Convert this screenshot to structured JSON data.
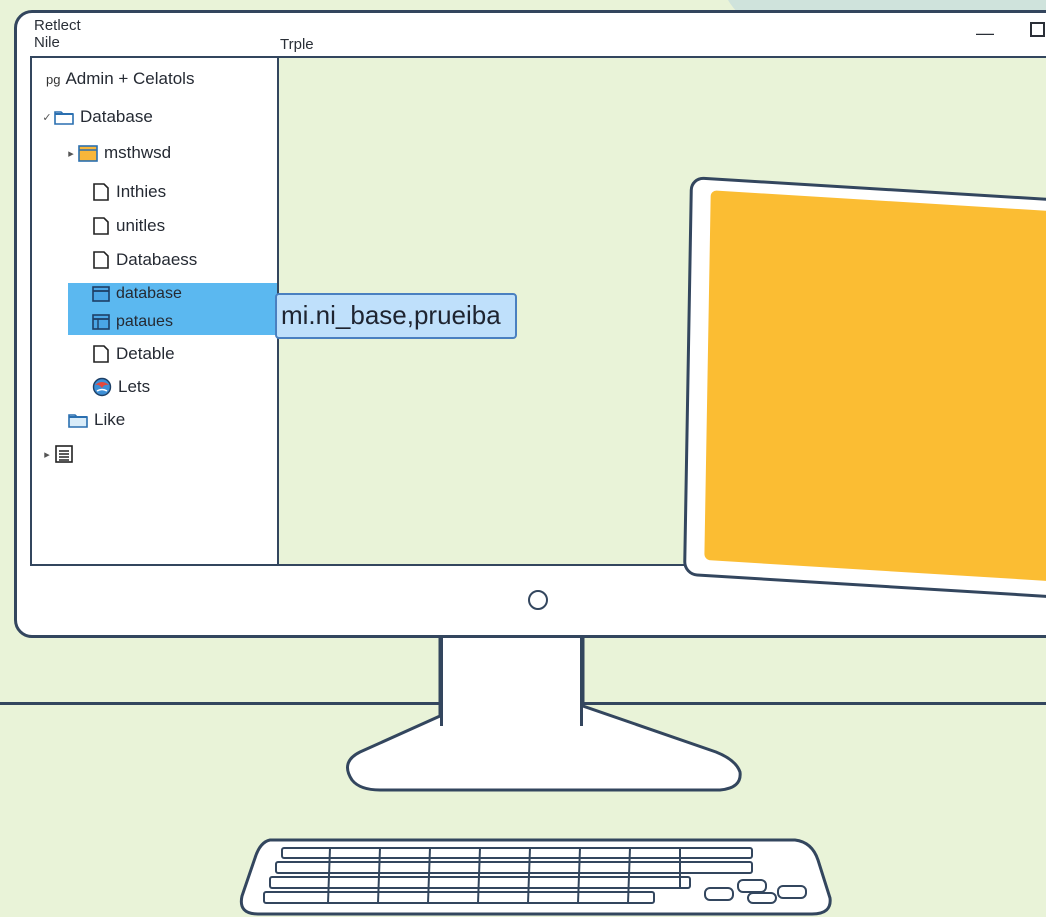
{
  "window": {
    "title": "Retlect",
    "menu_file": "Nile",
    "menu_table": "Trple",
    "minimize_glyph": "—"
  },
  "sidebar": {
    "root_label": "Admin + Celatols",
    "root_icon_text": "pg",
    "items": [
      {
        "label": "Database",
        "arrow": "✓",
        "icon": "folder-icon"
      },
      {
        "label": "msthwsd",
        "arrow": "▸",
        "icon": "table-folder-icon"
      },
      {
        "label": "Inthies",
        "arrow": "",
        "icon": "file-icon"
      },
      {
        "label": "unitles",
        "arrow": "",
        "icon": "file-icon"
      },
      {
        "label": "Databaess",
        "arrow": "",
        "icon": "file-icon"
      },
      {
        "label": "database",
        "arrow": "",
        "icon": "database-icon",
        "selected": true
      },
      {
        "label": "pataues",
        "arrow": "",
        "icon": "table-icon",
        "selected": true
      },
      {
        "label": "Detable",
        "arrow": "",
        "icon": "file-icon"
      },
      {
        "label": "Lets",
        "arrow": "",
        "icon": "globe-icon"
      },
      {
        "label": "Like",
        "arrow": "",
        "icon": "folder-icon"
      },
      {
        "label": "",
        "arrow": "▸",
        "icon": "list-icon"
      }
    ]
  },
  "rename_input": {
    "value": "mi.ni_base,prueiba"
  },
  "colors": {
    "background": "#e9f3d8",
    "selection": "#5bb8f0",
    "input_bg": "#bfe0fb",
    "tablet_screen": "#fbbd33",
    "outline": "#33465e"
  }
}
